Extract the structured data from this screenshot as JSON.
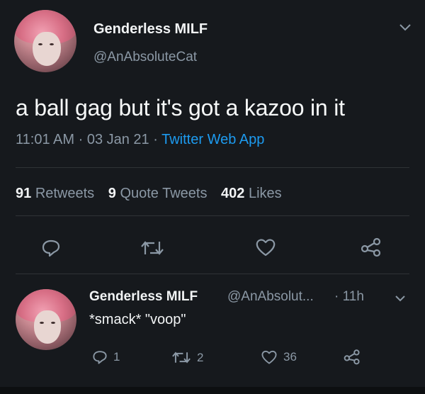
{
  "tweet": {
    "author_name": "Genderless MILF",
    "author_handle": "@AnAbsoluteCat",
    "text": "a ball gag but it's got a kazoo in it",
    "time": "11:01 AM",
    "sep1": "·",
    "date": "03 Jan 21",
    "sep2": "·",
    "app": "Twitter Web App",
    "stats": {
      "retweets_count": "91",
      "retweets_label": "Retweets",
      "quotes_count": "9",
      "quotes_label": "Quote Tweets",
      "likes_count": "402",
      "likes_label": "Likes"
    },
    "actions": [
      "reply-icon",
      "retweet-icon",
      "like-icon",
      "share-icon"
    ]
  },
  "reply": {
    "author_name": "Genderless MILF",
    "author_handle": "@AnAbsolut...",
    "time": "· 11h",
    "text": "*smack* \"voop\"",
    "reply_count": "1",
    "retweet_count": "2",
    "like_count": "36"
  },
  "colors": {
    "background": "#16191d",
    "link": "#1d9bf0",
    "secondary_text": "#8b98a5",
    "primary_text": "#f2f4f5"
  }
}
